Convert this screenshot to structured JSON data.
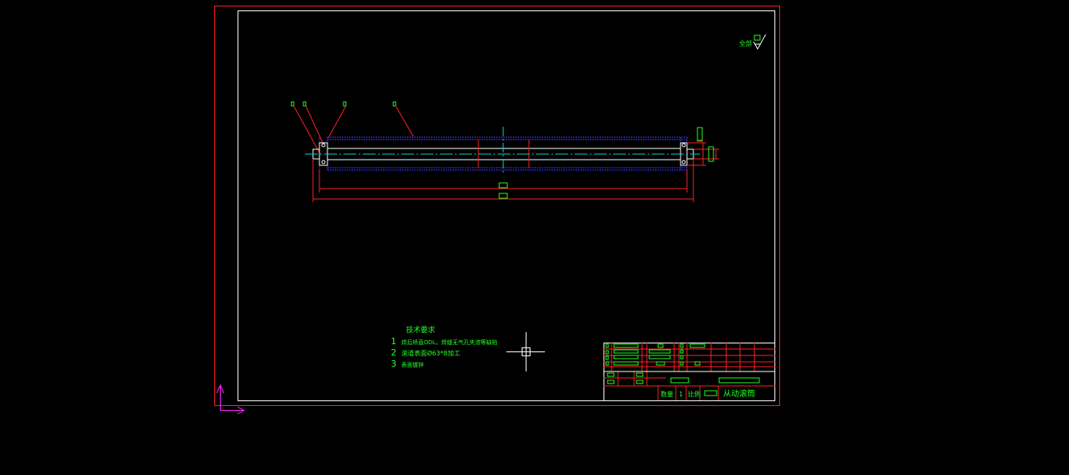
{
  "colors": {
    "background": "#000000",
    "sheet_border": "#ff2020",
    "frame": "#ffffff",
    "dimension": "#ff2020",
    "text": "#22ff22",
    "hidden_line": "#3b3bff",
    "center_line": "#00d5d5",
    "ucs_icon": "#ff22ff",
    "crosshair": "#ffffff"
  },
  "surface_finish": {
    "label": "全部",
    "icon": "roughness-symbol-icon"
  },
  "tech_requirements": {
    "title": "技术要求",
    "items": [
      {
        "num": "1",
        "text": "焊后矫直ODL，焊缝无气孔夹渣等缺陷"
      },
      {
        "num": "2",
        "text": "滚道表面Ø63*8加工"
      },
      {
        "num": "3",
        "text": "表面镀锌"
      }
    ]
  },
  "title_block": {
    "part_name": "从动滚筒",
    "quantity_label": "数量",
    "quantity_value": "1",
    "scale_label": "比例"
  },
  "icons": {
    "ucs": "ucs-axis-icon",
    "cursor": "crosshair-cursor-icon"
  }
}
